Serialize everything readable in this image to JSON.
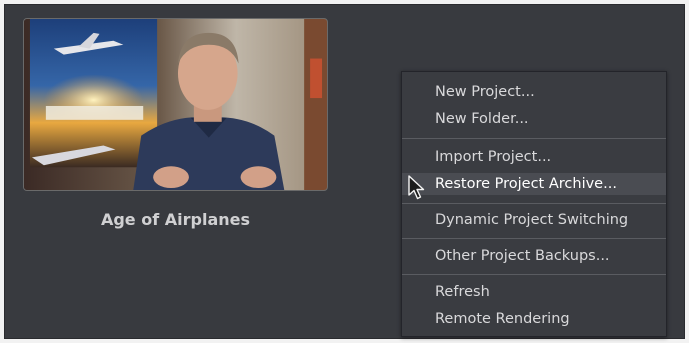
{
  "project": {
    "name": "Age of Airplanes"
  },
  "context_menu": {
    "items": [
      {
        "label": "New Project..."
      },
      {
        "label": "New Folder..."
      },
      {
        "label": "Import Project..."
      },
      {
        "label": "Restore Project Archive...",
        "highlighted": true
      },
      {
        "label": "Dynamic Project Switching"
      },
      {
        "label": "Other Project Backups..."
      },
      {
        "label": "Refresh"
      },
      {
        "label": "Remote Rendering"
      }
    ]
  },
  "colors": {
    "panel_bg": "#383a3f",
    "menu_bg": "#3a3c41",
    "menu_hover": "#4a4c52",
    "text": "#d9d9db"
  },
  "icons": [
    "mouse-pointer-icon"
  ]
}
